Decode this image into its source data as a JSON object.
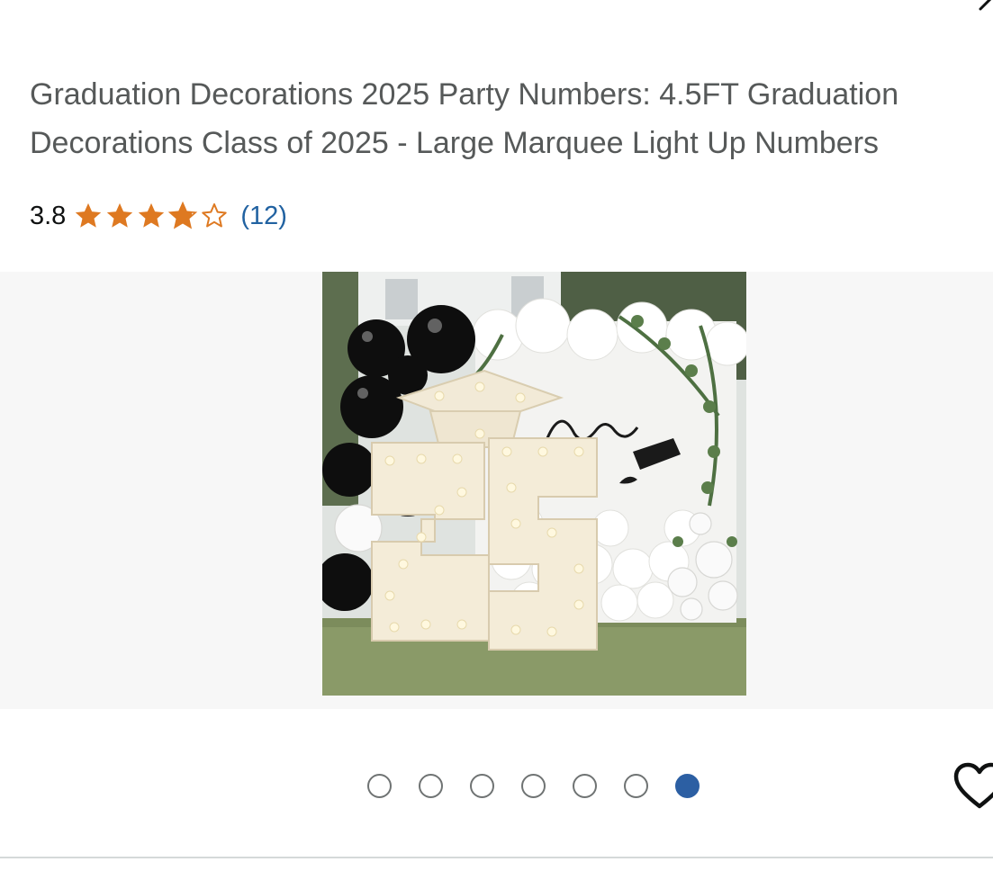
{
  "product": {
    "title": "Graduation Decorations 2025 Party Numbers: 4.5FT Graduation Decorations Class of 2025 - Large Marquee Light Up Numbers",
    "rating": {
      "value": "3.8",
      "stars": 3.8,
      "max_stars": 5,
      "count_label": "(12)"
    },
    "image": {
      "alt": "Light up marquee numbers 25 with graduation cap in front of balloon backdrop",
      "slide_count": 7,
      "active_slide": 7
    }
  },
  "colors": {
    "star": "#de7921",
    "link": "#2162a1",
    "active_dot": "#2c5fa3",
    "title_text": "#565959"
  },
  "icons": {
    "share": "share-icon",
    "wishlist": "heart-outline-icon"
  }
}
